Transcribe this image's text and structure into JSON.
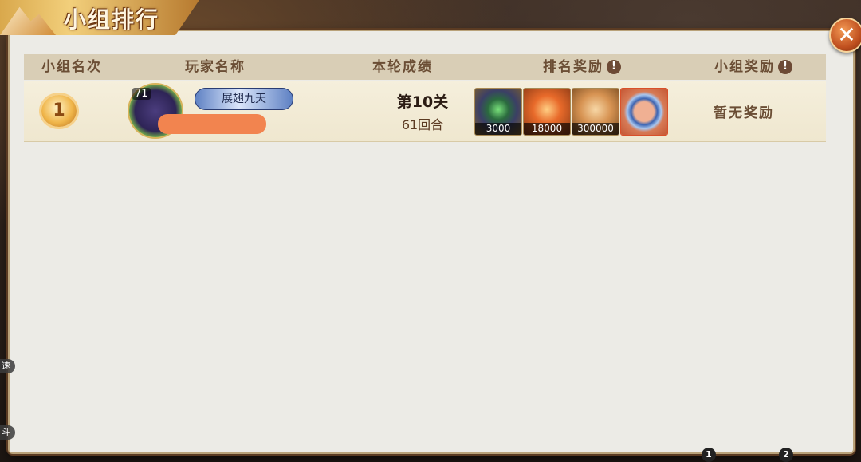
{
  "title": "小组排行",
  "close_icon": "close-icon",
  "columns": {
    "rank": "小组名次",
    "player": "玩家名称",
    "score": "本轮成绩",
    "rank_reward": "排名奖励",
    "group_reward": "小组奖励",
    "info_glyph": "!"
  },
  "rows": [
    {
      "rank": "1",
      "level": "71",
      "player_title": "展翅九天",
      "stage": "第10关",
      "rounds": "61回合",
      "rewards": [
        {
          "item": "jade-chest",
          "qty": "3000"
        },
        {
          "item": "fire-orb",
          "qty": "18000"
        },
        {
          "item": "copper-coin",
          "qty": "300000"
        },
        {
          "item": "spirit-ring",
          "qty": ""
        }
      ],
      "group_reward": "暂无奖励"
    }
  ],
  "side_tags": [
    "速",
    "斗"
  ],
  "pages": [
    "1",
    "2"
  ],
  "colors": {
    "panel": "#ecebe6",
    "header": "#d9ceb6",
    "accent": "#6b4e35",
    "close": "#c0501f"
  }
}
